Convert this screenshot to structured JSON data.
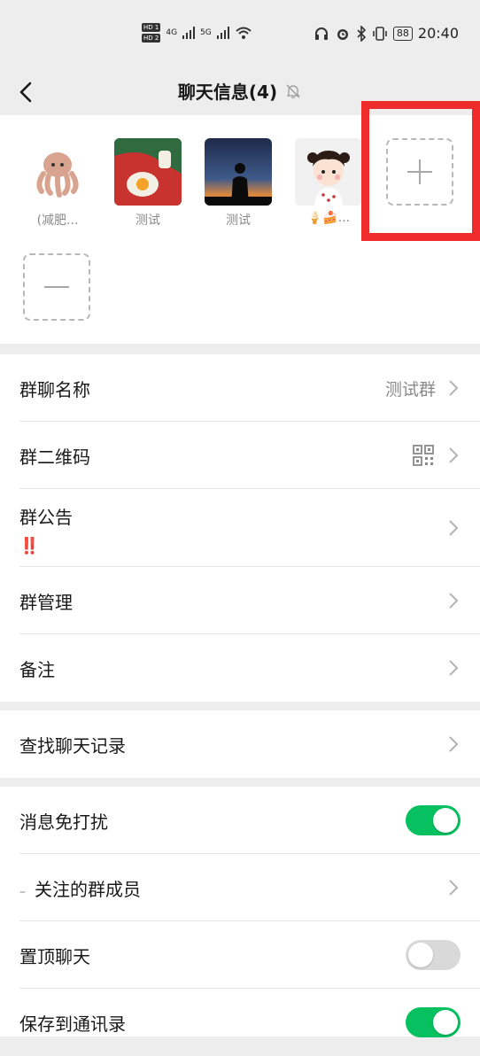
{
  "status_bar": {
    "network_left": "4G",
    "network_right": "5G",
    "hd1": "HD 1",
    "hd2": "HD 2",
    "battery": "88",
    "time": "20:40"
  },
  "navbar": {
    "title": "聊天信息(4)",
    "back_icon": "chevron-left-icon",
    "mute_icon": "bell-off-icon"
  },
  "members": [
    {
      "name": "(减肥..."
    },
    {
      "name": "测试"
    },
    {
      "name": "测试"
    },
    {
      "name": "🍦🍰..."
    }
  ],
  "member_actions": {
    "add_icon": "plus-icon",
    "remove_icon": "minus-icon"
  },
  "settings": {
    "group_name_label": "群聊名称",
    "group_name_value": "测试群",
    "qr_label": "群二维码",
    "notice_label": "群公告",
    "notice_badge": "‼️",
    "manage_label": "群管理",
    "remark_label": "备注",
    "search_history_label": "查找聊天记录",
    "mute_label": "消息免打扰",
    "mute_on": true,
    "followed_label": "关注的群成员",
    "followed_prefix": "–",
    "pin_label": "置顶聊天",
    "pin_on": false,
    "save_contacts_label": "保存到通讯录",
    "save_contacts_on": true
  },
  "colors": {
    "toggle_on": "#07c160",
    "toggle_off": "#d9d9d9",
    "highlight": "#ee2c2c"
  }
}
